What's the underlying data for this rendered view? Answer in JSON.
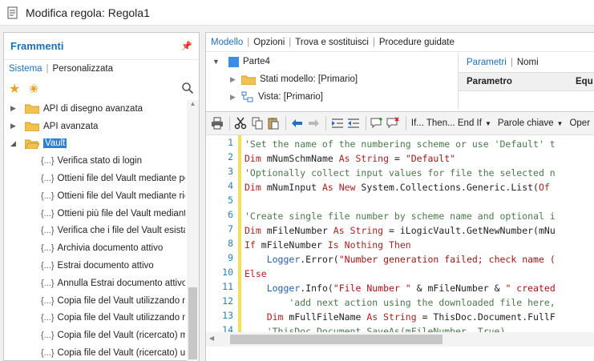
{
  "window": {
    "title": "Modifica regola: Regola1"
  },
  "left_panel": {
    "title": "Frammenti",
    "tabs": [
      "Sistema",
      "Personalizzata"
    ],
    "tree": [
      {
        "type": "folder",
        "label": "API di disegno avanzata",
        "expanded": false
      },
      {
        "type": "folder",
        "label": "API avanzata",
        "expanded": false
      },
      {
        "type": "folder",
        "label": "Vault",
        "expanded": true,
        "selected": true
      },
      {
        "type": "snippet",
        "label": "Verifica stato di login"
      },
      {
        "type": "snippet",
        "label": "Ottieni file del Vault mediante pe"
      },
      {
        "type": "snippet",
        "label": "Ottieni file del Vault mediante rice"
      },
      {
        "type": "snippet",
        "label": "Ottieni più file del Vault mediante"
      },
      {
        "type": "snippet",
        "label": "Verifica che i file del Vault esista"
      },
      {
        "type": "snippet",
        "label": "Archivia documento attivo"
      },
      {
        "type": "snippet",
        "label": "Estrai documento attivo"
      },
      {
        "type": "snippet",
        "label": "Annulla Estrai documento attivo"
      },
      {
        "type": "snippet",
        "label": "Copia file del Vault utilizzando nu"
      },
      {
        "type": "snippet",
        "label": "Copia file del Vault utilizzando nu"
      },
      {
        "type": "snippet",
        "label": "Copia file del Vault (ricercato) me"
      },
      {
        "type": "snippet",
        "label": "Copia file del Vault (ricercato) uti"
      }
    ],
    "snippet_prefix": "{...}"
  },
  "right_panel": {
    "tabs": [
      "Modello",
      "Opzioni",
      "Trova e sostituisci",
      "Procedure guidate"
    ],
    "model_tree": [
      {
        "label": "Parte4"
      },
      {
        "label": "Stati modello: [Primario]"
      },
      {
        "label": "Vista: [Primario]"
      }
    ],
    "param_tabs": [
      "Parametri",
      "Nomi"
    ],
    "param_columns": [
      "Parametro",
      "Equ"
    ]
  },
  "toolbar": {
    "if_then_label": "If... Then... End If",
    "keywords_label": "Parole chiave",
    "operators_label": "Oper"
  },
  "code": {
    "line_numbers": [
      "1",
      "2",
      "3",
      "4",
      "5",
      "6",
      "7",
      "8",
      "9",
      "10",
      "11",
      "12",
      "13",
      "14"
    ],
    "lines": [
      [
        {
          "t": "cm",
          "v": "'Set the name of the numbering scheme or use 'Default' t"
        }
      ],
      [
        {
          "t": "kw",
          "v": "Dim "
        },
        {
          "t": "plain",
          "v": "mNumSchmName "
        },
        {
          "t": "kw",
          "v": "As String"
        },
        {
          "t": "plain",
          "v": " = "
        },
        {
          "t": "str",
          "v": "\"Default\""
        }
      ],
      [
        {
          "t": "cm",
          "v": "'Optionally collect input values for file the selected n"
        }
      ],
      [
        {
          "t": "kw",
          "v": "Dim "
        },
        {
          "t": "plain",
          "v": "mNumInput "
        },
        {
          "t": "kw",
          "v": "As New "
        },
        {
          "t": "plain",
          "v": "System.Collections.Generic.List("
        },
        {
          "t": "kw",
          "v": "Of"
        }
      ],
      [
        {
          "t": "plain",
          "v": ""
        }
      ],
      [
        {
          "t": "cm",
          "v": "'Create single file number by scheme name and optional i"
        }
      ],
      [
        {
          "t": "kw",
          "v": "Dim "
        },
        {
          "t": "plain",
          "v": "mFileNumber "
        },
        {
          "t": "kw",
          "v": "As String"
        },
        {
          "t": "plain",
          "v": " = iLogicVault.GetNewNumber(mNu"
        }
      ],
      [
        {
          "t": "kw",
          "v": "If "
        },
        {
          "t": "plain",
          "v": "mFileNumber "
        },
        {
          "t": "kw",
          "v": "Is Nothing Then"
        }
      ],
      [
        {
          "t": "plain",
          "v": "    "
        },
        {
          "t": "obj",
          "v": "Logger"
        },
        {
          "t": "plain",
          "v": ".Error("
        },
        {
          "t": "str",
          "v": "\"Number generation failed; check name ("
        }
      ],
      [
        {
          "t": "kw",
          "v": "Else"
        }
      ],
      [
        {
          "t": "plain",
          "v": "    "
        },
        {
          "t": "obj",
          "v": "Logger"
        },
        {
          "t": "plain",
          "v": ".Info("
        },
        {
          "t": "str",
          "v": "\"File Number \""
        },
        {
          "t": "plain",
          "v": " & mFileNumber & "
        },
        {
          "t": "str",
          "v": "\" created"
        }
      ],
      [
        {
          "t": "cm",
          "v": "        'add next action using the downloaded file here,"
        }
      ],
      [
        {
          "t": "plain",
          "v": "    "
        },
        {
          "t": "kw",
          "v": "Dim "
        },
        {
          "t": "plain",
          "v": "mFullFileName "
        },
        {
          "t": "kw",
          "v": "As String"
        },
        {
          "t": "plain",
          "v": " = ThisDoc.Document.FullF"
        }
      ],
      [
        {
          "t": "cm",
          "v": "    'ThisDoc.Document.SaveAs(mFileNumber, True)"
        }
      ]
    ]
  }
}
